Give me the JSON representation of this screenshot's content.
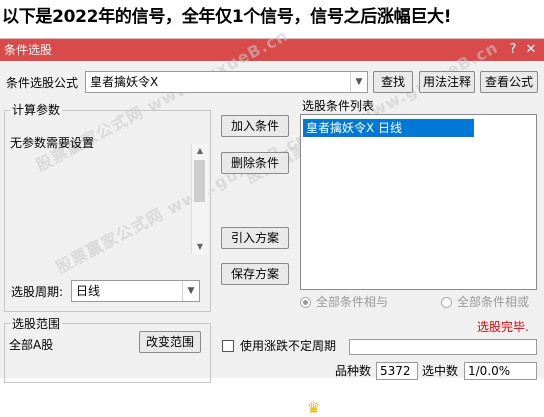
{
  "headline": "以下是2022年的信号，全年仅1个信号，信号之后涨幅巨大!",
  "window": {
    "title": "条件选股",
    "help_glyph": "?",
    "close_glyph": "✕"
  },
  "formula": {
    "label": "条件选股公式",
    "value": "皇者擒妖令X",
    "buttons": [
      "查找",
      "用法注释",
      "查看公式"
    ]
  },
  "params": {
    "group_title": "计算参数",
    "text": "无参数需要设置"
  },
  "period": {
    "label": "选股周期:",
    "value": "日线"
  },
  "actions": [
    "加入条件",
    "删除条件",
    "引入方案",
    "保存方案"
  ],
  "condition_list": {
    "title": "选股条件列表",
    "items": [
      "皇者擒妖令X  日线"
    ]
  },
  "logic": {
    "and_label": "全部条件相与",
    "or_label": "全部条件相或"
  },
  "status": "选股完毕.",
  "scope": {
    "group_title": "选股范围",
    "value": "全部A股",
    "change_button": "改变范围"
  },
  "unfixed_period": {
    "label": "使用涨跌不定周期"
  },
  "counts": {
    "total_label": "品种数",
    "total_value": "5372",
    "selected_label": "选中数",
    "selected_value": "1/0.0%"
  },
  "watermark_text": "股票赢家公式网 www.guxueB.cn",
  "colors": {
    "titlebar": "#d94b4b",
    "selection": "#0078d7",
    "status": "#e00000"
  }
}
